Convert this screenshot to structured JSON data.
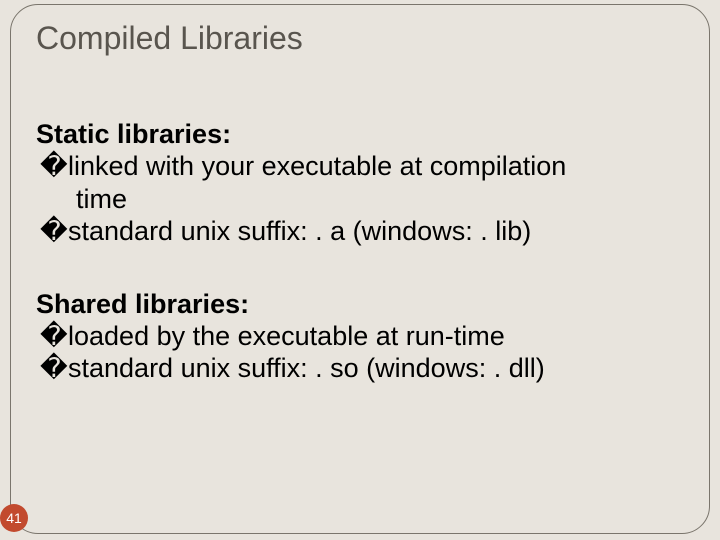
{
  "title": "Compiled Libraries",
  "sections": [
    {
      "heading": "Static libraries:",
      "bullets": [
        "linked with your executable at compilation time",
        "standard unix suffix: . a (windows: . lib)"
      ]
    },
    {
      "heading": "Shared libraries:",
      "bullets": [
        "loaded by the executable at run-time",
        "standard unix suffix: . so (windows: . dll)"
      ]
    }
  ],
  "bullet_glyph": "�",
  "page_number": "41"
}
